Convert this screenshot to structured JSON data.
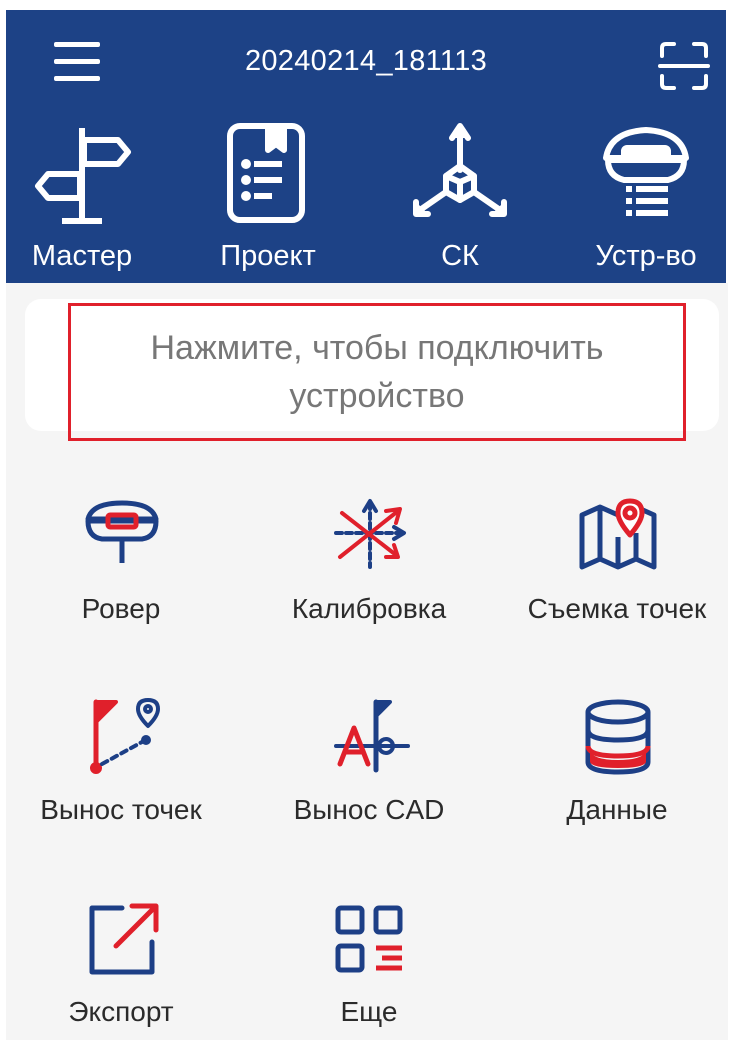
{
  "header": {
    "title": "20240214_181113",
    "menu_icon": "hamburger-menu-icon",
    "scan_icon": "scan-icon"
  },
  "top_nav": [
    {
      "label": "Мастер",
      "icon": "signpost-icon"
    },
    {
      "label": "Проект",
      "icon": "project-document-icon"
    },
    {
      "label": "СК",
      "icon": "coordinate-system-icon"
    },
    {
      "label": "Устр-во",
      "icon": "gnss-receiver-icon"
    }
  ],
  "connect": {
    "label": "Нажмите, чтобы подключить устройство"
  },
  "tiles": [
    {
      "label": "Ровер",
      "icon": "rover-icon"
    },
    {
      "label": "Калибровка",
      "icon": "calibration-icon"
    },
    {
      "label": "Съемка точек",
      "icon": "point-survey-map-icon"
    },
    {
      "label": "Вынос точек",
      "icon": "stakeout-points-icon"
    },
    {
      "label": "Вынос CAD",
      "icon": "stakeout-cad-icon"
    },
    {
      "label": "Данные",
      "icon": "database-icon"
    },
    {
      "label": "Экспорт",
      "icon": "export-icon"
    },
    {
      "label": "Еще",
      "icon": "more-grid-icon"
    }
  ],
  "colors": {
    "header_bg": "#1d4286",
    "accent_red": "#e0202b",
    "icon_blue": "#1d3f86",
    "page_bg": "#f5f5f5"
  }
}
